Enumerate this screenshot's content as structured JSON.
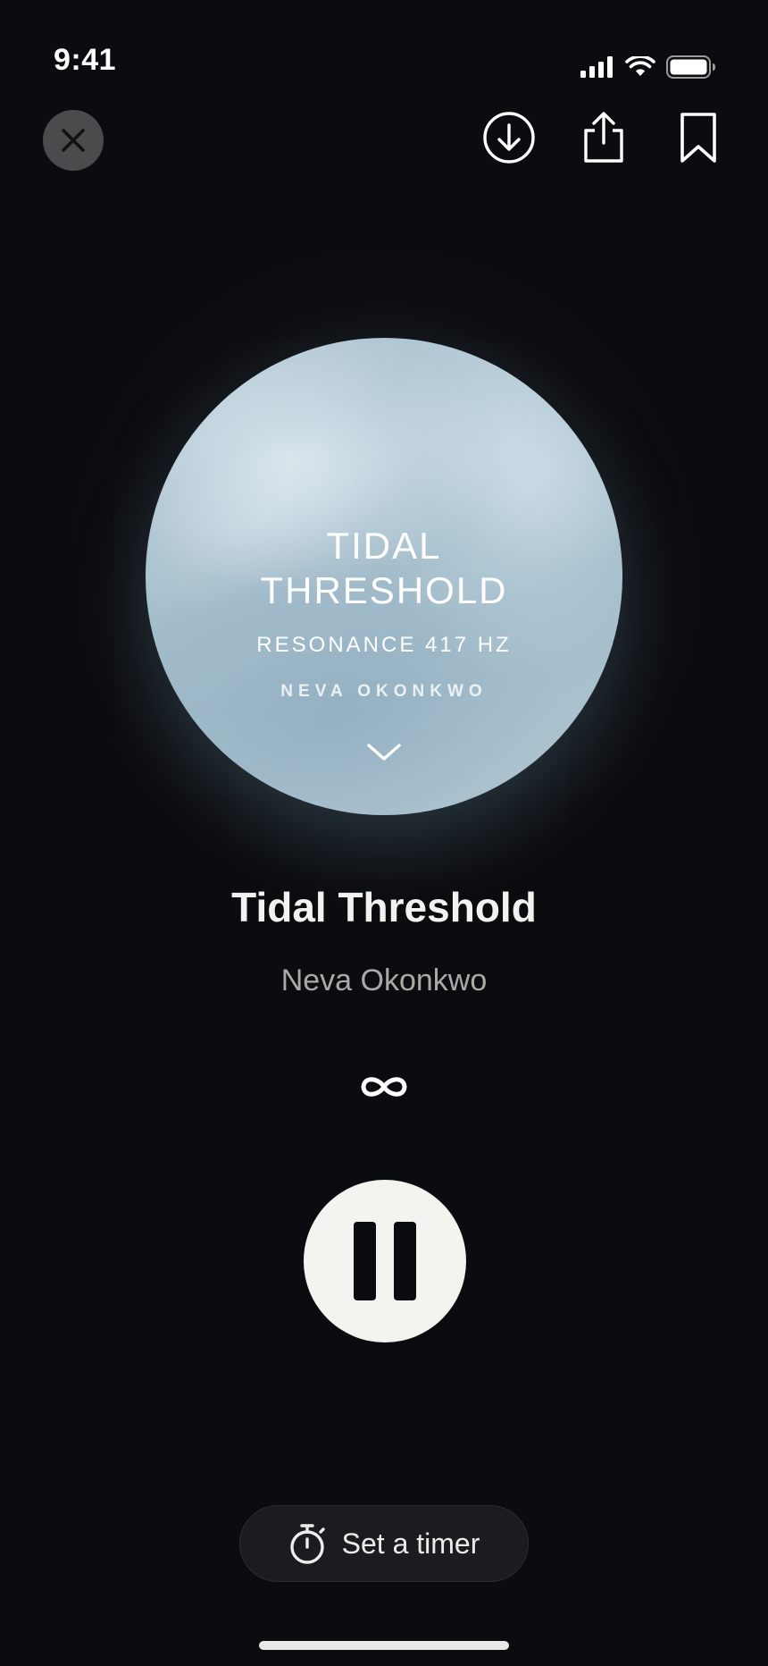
{
  "status_bar": {
    "time": "9:41",
    "icons": [
      "cellular-signal-icon",
      "wifi-icon",
      "battery-icon"
    ]
  },
  "top_bar": {
    "close_icon": "close-icon",
    "actions": [
      "download-icon",
      "share-icon",
      "bookmark-icon"
    ]
  },
  "artwork": {
    "title_line1": "TIDAL",
    "title_line2": "THRESHOLD",
    "subtitle": "RESONANCE 417 HZ",
    "artist": "NEVA OKONKWO",
    "chevron_icon": "chevron-down-icon"
  },
  "track": {
    "title": "Tidal Threshold",
    "artist": "Neva Okonkwo"
  },
  "controls": {
    "loop_icon": "infinity-icon",
    "pause_icon": "pause-icon"
  },
  "timer": {
    "label": "Set a timer",
    "icon": "stopwatch-icon"
  },
  "colors": {
    "background": "#0b0c0f",
    "pause_button": "#f3f4f0",
    "close_button": "#4a4b4d",
    "timer_button": "#1b1c1f",
    "secondary_text": "#a9aaa8"
  }
}
